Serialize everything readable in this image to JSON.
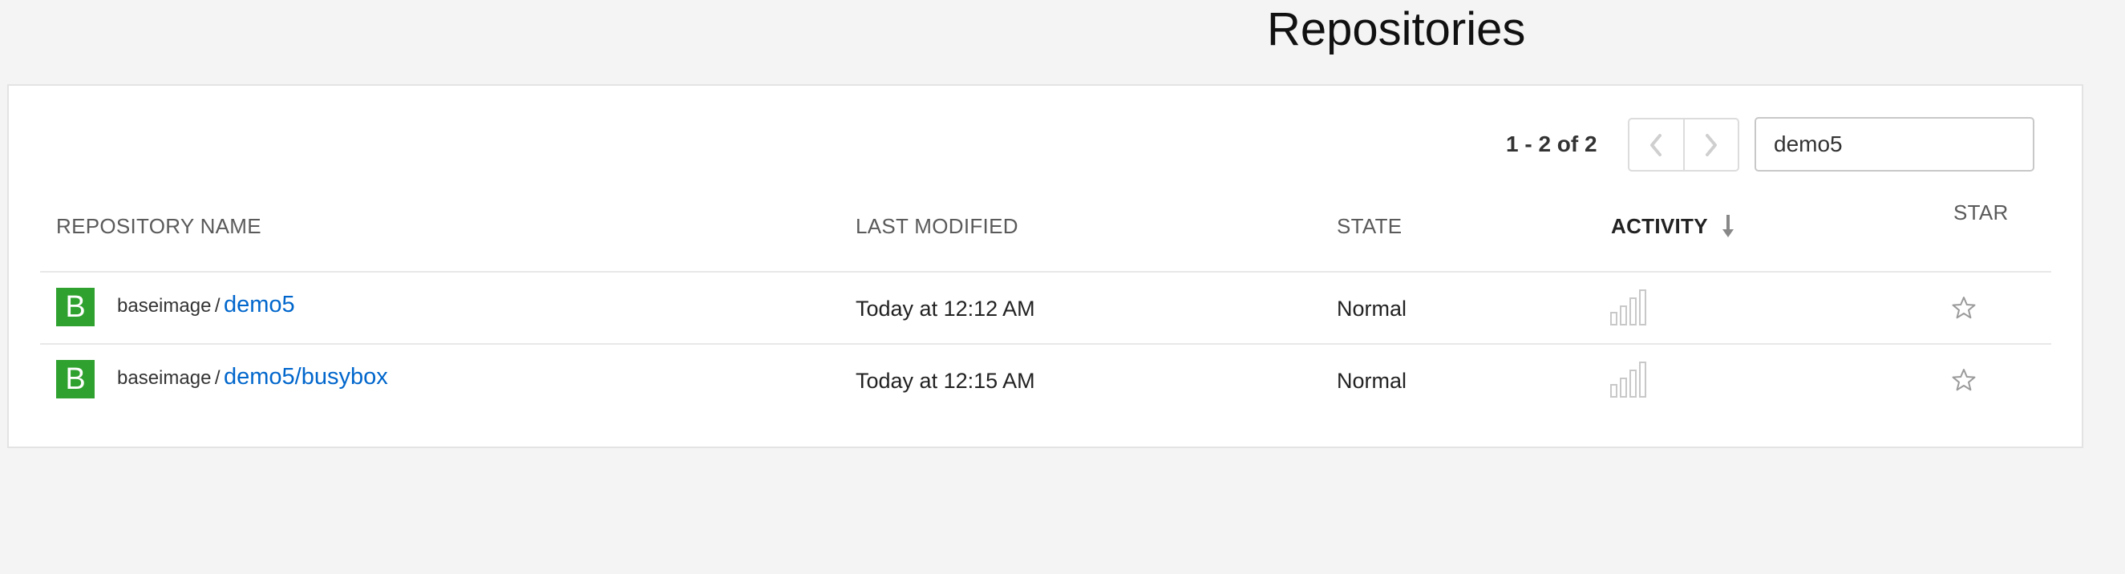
{
  "page": {
    "title": "Repositories"
  },
  "pager": {
    "count_label": "1 - 2 of 2"
  },
  "search": {
    "value": "demo5"
  },
  "table": {
    "columns": {
      "name": "REPOSITORY NAME",
      "modified": "LAST MODIFIED",
      "state": "STATE",
      "activity": "ACTIVITY",
      "star": "STAR"
    },
    "rows": [
      {
        "avatar_letter": "B",
        "namespace": "baseimage",
        "separator": "/",
        "name": "demo5",
        "last_modified": "Today at 12:12 AM",
        "state": "Normal"
      },
      {
        "avatar_letter": "B",
        "namespace": "baseimage",
        "separator": "/",
        "name": "demo5/busybox",
        "last_modified": "Today at 12:15 AM",
        "state": "Normal"
      }
    ]
  },
  "icons": {
    "prev": "chevron-left-icon",
    "next": "chevron-right-icon",
    "sort": "sort-descending-icon",
    "activity": "activity-bars-icon",
    "star": "star-outline-icon"
  },
  "colors": {
    "avatar": "#2fa12f",
    "link": "#0066cc",
    "page_bg": "#f4f4f4"
  }
}
